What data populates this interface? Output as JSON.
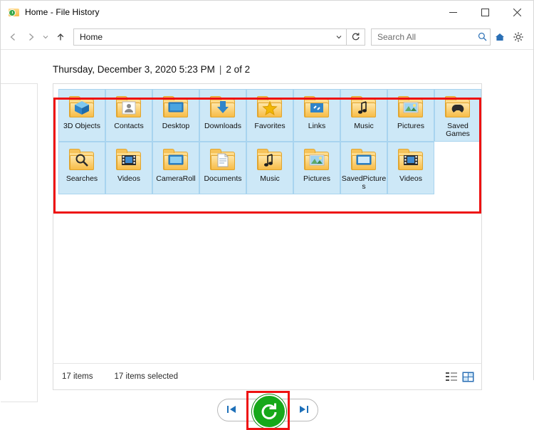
{
  "window": {
    "title": "Home - File History",
    "icon": "file-history-icon",
    "controls": {
      "minimize": "–",
      "maximize": "▢",
      "close": "✕"
    }
  },
  "address_bar": {
    "back": "back-arrow",
    "forward": "forward-arrow",
    "recent": "chevron-down",
    "up": "up-arrow",
    "path_value": "Home",
    "dropdown": "chevron-down",
    "refresh": "refresh-icon",
    "search_placeholder": "Search All",
    "search_value": "",
    "search_icon": "search-icon",
    "home_icon": "home-icon",
    "settings_icon": "gear-icon"
  },
  "header": {
    "timestamp": "Thursday, December 3, 2020 5:23 PM",
    "separator": "|",
    "counter": "2 of 2"
  },
  "items": [
    {
      "label": "3D Objects",
      "icon": "3d-objects-folder-icon",
      "selected": true
    },
    {
      "label": "Contacts",
      "icon": "contacts-folder-icon",
      "selected": true
    },
    {
      "label": "Desktop",
      "icon": "desktop-folder-icon",
      "selected": true
    },
    {
      "label": "Downloads",
      "icon": "downloads-folder-icon",
      "selected": true
    },
    {
      "label": "Favorites",
      "icon": "favorites-folder-icon",
      "selected": true
    },
    {
      "label": "Links",
      "icon": "links-folder-icon",
      "selected": true
    },
    {
      "label": "Music",
      "icon": "music-folder-icon",
      "selected": true
    },
    {
      "label": "Pictures",
      "icon": "pictures-folder-icon",
      "selected": true
    },
    {
      "label": "Saved Games",
      "icon": "saved-games-folder-icon",
      "selected": true
    },
    {
      "label": "Searches",
      "icon": "searches-folder-icon",
      "selected": true
    },
    {
      "label": "Videos",
      "icon": "videos-folder-icon",
      "selected": true
    },
    {
      "label": "CameraRoll",
      "icon": "camera-roll-folder-icon",
      "selected": true
    },
    {
      "label": "Documents",
      "icon": "documents-folder-icon",
      "selected": true
    },
    {
      "label": "Music",
      "icon": "music-folder-icon",
      "selected": true
    },
    {
      "label": "Pictures",
      "icon": "pictures-folder-icon",
      "selected": true
    },
    {
      "label": "SavedPictures",
      "icon": "saved-pictures-folder-icon",
      "selected": true
    },
    {
      "label": "Videos",
      "icon": "videos-folder-icon",
      "selected": true
    }
  ],
  "status_bar": {
    "item_count": "17 items",
    "selection_count": "17 items selected",
    "view_details_icon": "details-view-icon",
    "view_thumbnails_icon": "large-icons-view-icon"
  },
  "bottom_toolbar": {
    "previous_label": "previous-version-icon",
    "next_label": "next-version-icon",
    "restore_label": "restore-button"
  },
  "colors": {
    "selection_highlight": "#cde8f7",
    "annotation_red": "#ee1111",
    "restore_green": "#17a81a",
    "accent_blue": "#2a6fb5"
  }
}
